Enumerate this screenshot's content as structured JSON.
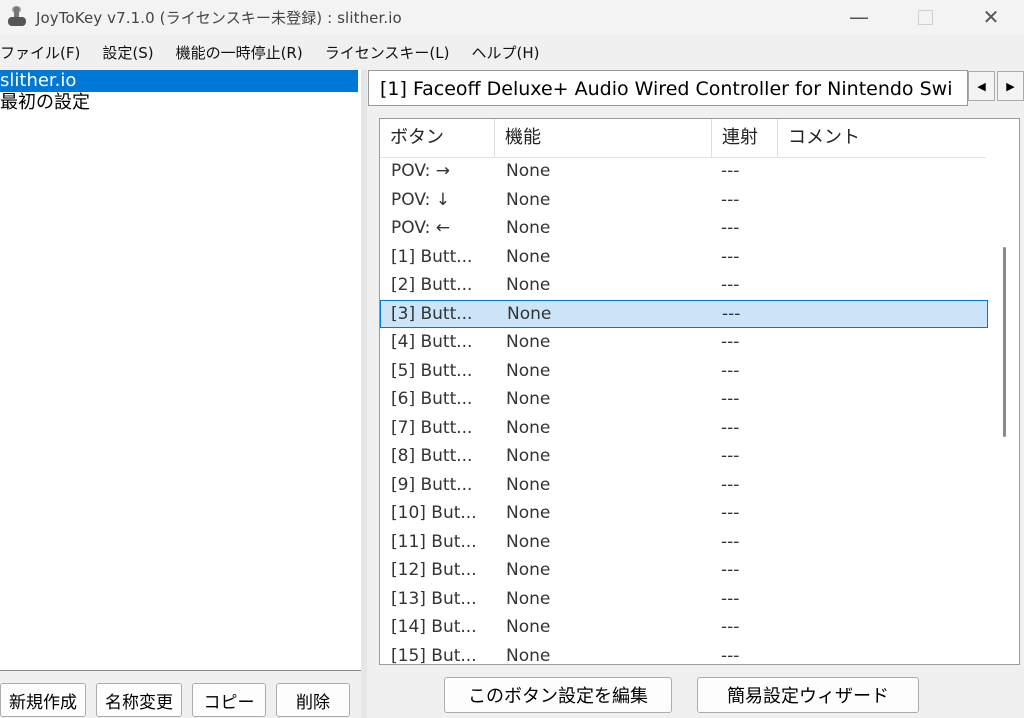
{
  "window": {
    "title": "JoyToKey v7.1.0 (ライセンスキー未登録) : slither.io"
  },
  "menu": [
    "ファイル(F)",
    "設定(S)",
    "機能の一時停止(R)",
    "ライセンスキー(L)",
    "ヘルプ(H)"
  ],
  "profiles": [
    "slither.io",
    "最初の設定"
  ],
  "left_buttons": {
    "new": "新規作成",
    "rename": "名称変更",
    "copy": "コピー",
    "delete": "削除"
  },
  "controller": {
    "title": "[1] Faceoff Deluxe+ Audio Wired Controller for Nintendo Swi"
  },
  "icons": {
    "app": "joystick-icon",
    "prev": "arrow-left-icon",
    "next": "arrow-right-icon"
  },
  "table": {
    "headers": {
      "button": "ボタン",
      "function": "機能",
      "turbo": "連射",
      "comment": "コメント"
    },
    "rows": [
      {
        "button": "POV: →",
        "function": "None",
        "turbo": "---"
      },
      {
        "button": "POV: ↓",
        "function": "None",
        "turbo": "---"
      },
      {
        "button": "POV: ←",
        "function": "None",
        "turbo": "---"
      },
      {
        "button": "[1] Butt...",
        "function": "None",
        "turbo": "---"
      },
      {
        "button": "[2] Butt...",
        "function": "None",
        "turbo": "---"
      },
      {
        "button": "[3] Butt...",
        "function": "None",
        "turbo": "---"
      },
      {
        "button": "[4] Butt...",
        "function": "None",
        "turbo": "---"
      },
      {
        "button": "[5] Butt...",
        "function": "None",
        "turbo": "---"
      },
      {
        "button": "[6] Butt...",
        "function": "None",
        "turbo": "---"
      },
      {
        "button": "[7] Butt...",
        "function": "None",
        "turbo": "---"
      },
      {
        "button": "[8] Butt...",
        "function": "None",
        "turbo": "---"
      },
      {
        "button": "[9] Butt...",
        "function": "None",
        "turbo": "---"
      },
      {
        "button": "[10] But...",
        "function": "None",
        "turbo": "---"
      },
      {
        "button": "[11] But...",
        "function": "None",
        "turbo": "---"
      },
      {
        "button": "[12] But...",
        "function": "None",
        "turbo": "---"
      },
      {
        "button": "[13] But...",
        "function": "None",
        "turbo": "---"
      },
      {
        "button": "[14] But...",
        "function": "None",
        "turbo": "---"
      },
      {
        "button": "[15] But...",
        "function": "None",
        "turbo": "---"
      }
    ]
  },
  "right_buttons": {
    "edit": "このボタン設定を編集",
    "wizard": "簡易設定ウィザード"
  }
}
